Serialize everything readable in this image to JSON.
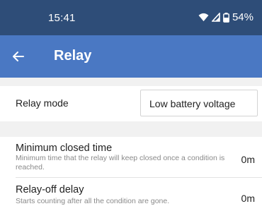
{
  "status_bar": {
    "time": "15:41",
    "battery_percent": "54%",
    "icons": [
      "wifi-icon",
      "cellular-signal-icon",
      "battery-icon"
    ]
  },
  "app_bar": {
    "back_icon": "arrow-left-icon",
    "title": "Relay",
    "color": "#4a78c3"
  },
  "relay_mode": {
    "label": "Relay mode",
    "selected_value": "Low battery voltage"
  },
  "settings": [
    {
      "title": "Minimum closed time",
      "description": "Minimum time that the relay will keep closed once a condition is reached.",
      "value": "0m"
    },
    {
      "title": "Relay-off delay",
      "description": "Starts counting after all the condition are gone.",
      "value": "0m"
    }
  ]
}
